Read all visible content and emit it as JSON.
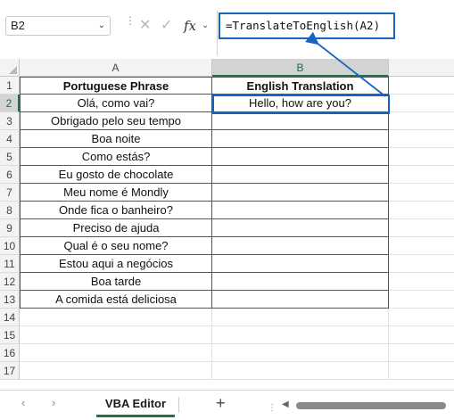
{
  "formula_bar": {
    "name_box": "B2",
    "chevron": "⌄",
    "separator": "⋮",
    "cancel_icon": "✕",
    "enter_icon": "✓",
    "fx_label": "fx",
    "fx_chevron": "⌄",
    "formula": "=TranslateToEnglish(A2)"
  },
  "grid": {
    "columns": [
      "A",
      "B"
    ],
    "selected_column": "B",
    "rows": [
      "1",
      "2",
      "3",
      "4",
      "5",
      "6",
      "7",
      "8",
      "9",
      "10",
      "11",
      "12",
      "13",
      "14",
      "15",
      "16",
      "17"
    ],
    "selected_row": "2",
    "headers": [
      "Portuguese Phrase",
      "English Translation"
    ],
    "col_a": [
      "Olá, como vai?",
      "Obrigado pelo seu tempo",
      "Boa noite",
      "Como estás?",
      "Eu gosto de chocolate",
      "Meu nome é Mondly",
      "Onde fica o banheiro?",
      "Preciso de ajuda",
      "Qual é o seu nome?",
      "Estou aqui a negócios",
      "Boa tarde",
      "A comida está deliciosa"
    ],
    "col_b": [
      "Hello, how are you?",
      "",
      "",
      "",
      "",
      "",
      "",
      "",
      "",
      "",
      "",
      ""
    ]
  },
  "sheet_tabs": {
    "prev": "‹",
    "next": "›",
    "active_tab": "VBA Editor",
    "add_sheet": "+",
    "scroll_dots": "⋮",
    "scroll_left": "◀"
  },
  "colors": {
    "accent_green": "#217346",
    "annotation_blue": "#1565c0"
  }
}
